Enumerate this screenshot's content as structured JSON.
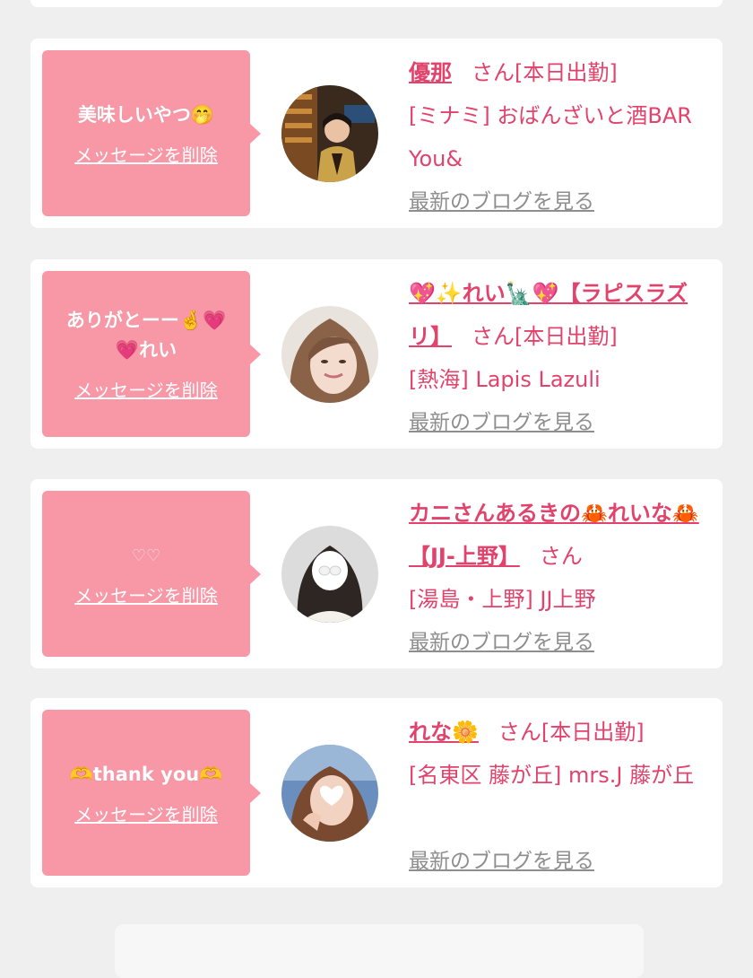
{
  "delete_label": "メッセージを削除",
  "blog_label": "最新のブログを見る",
  "cards": [
    {
      "message": "美味しいやつ🤭",
      "name": "優那",
      "suffix": "さん[本日出勤]",
      "shop": "[ミナミ] おばんざいと酒BAR You&"
    },
    {
      "message": "ありがとーー🤞💗💗れい",
      "name": "💖✨れい🗽💖【ラピスラズリ】",
      "suffix": "さん[本日出勤]",
      "shop": "[熱海] Lapis Lazuli"
    },
    {
      "message": "♡♡",
      "name": "カニさんあるきの🦀れいな🦀【JJ-上野】",
      "suffix": "さん",
      "shop": "[湯島・上野] JJ上野"
    },
    {
      "message": "🫶thank you🫶",
      "name": "れな🌼",
      "suffix": "さん[本日出勤]",
      "shop": "[名東区 藤が丘] mrs.J 藤が丘"
    }
  ],
  "colors": {
    "bubble": "#f898a7",
    "accent": "#e1436c",
    "link_gray": "#8e8e8e",
    "background": "#efefef"
  }
}
